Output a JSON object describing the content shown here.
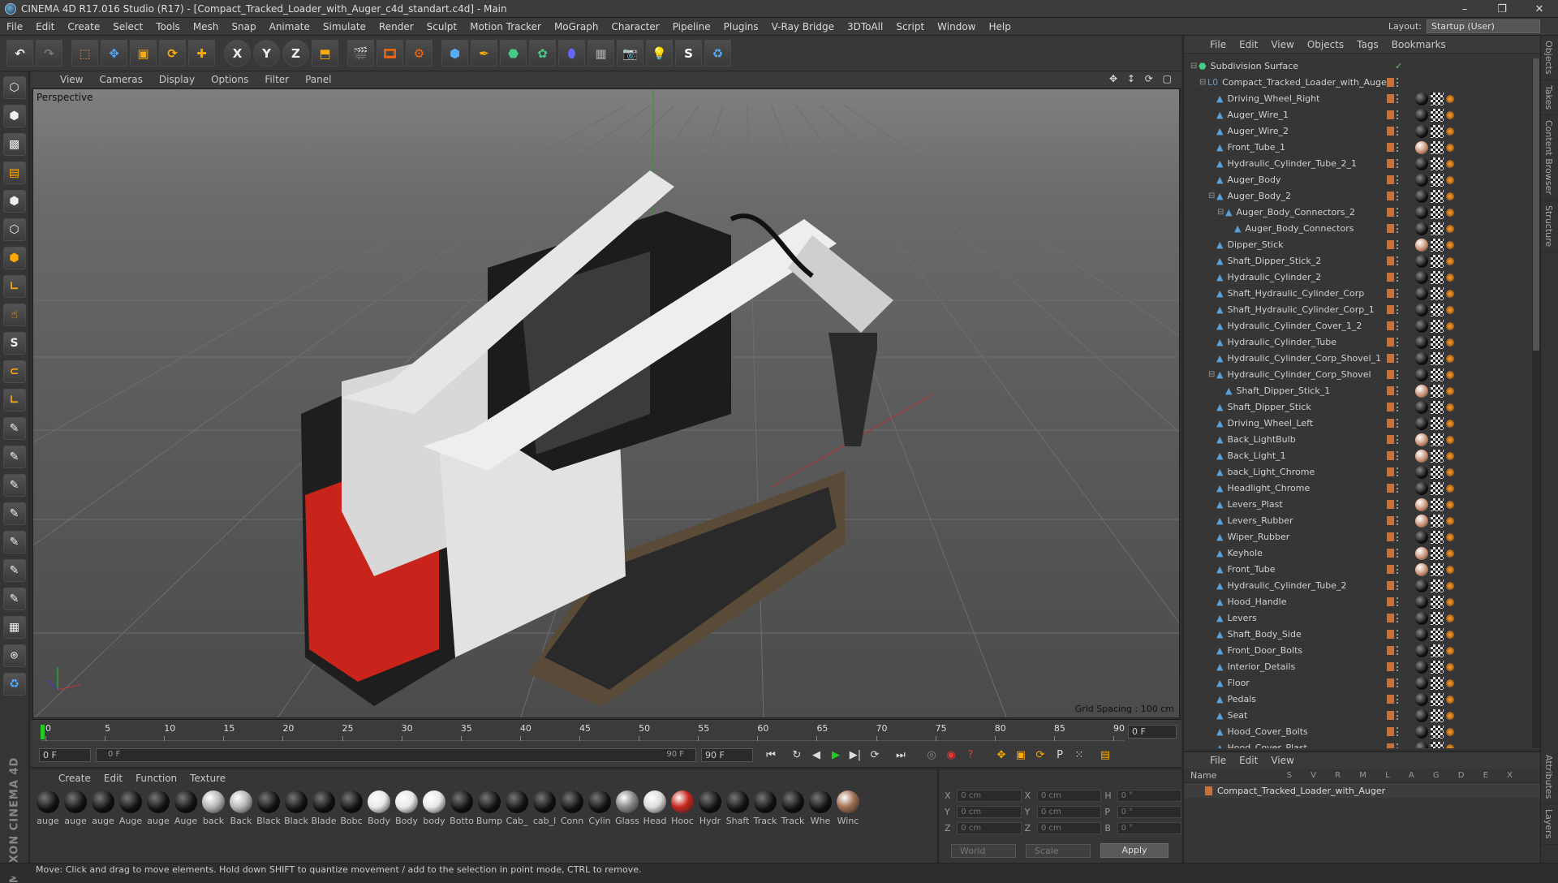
{
  "app": {
    "title": "CINEMA 4D R17.016 Studio (R17) - [Compact_Tracked_Loader_with_Auger_c4d_standart.c4d] - Main",
    "window_controls": [
      "–",
      "❐",
      "✕"
    ]
  },
  "menu": [
    "File",
    "Edit",
    "Create",
    "Select",
    "Tools",
    "Mesh",
    "Snap",
    "Animate",
    "Simulate",
    "Render",
    "Sculpt",
    "Motion Tracker",
    "MoGraph",
    "Character",
    "Pipeline",
    "Plugins",
    "V-Ray Bridge",
    "3DToAll",
    "Script",
    "Window",
    "Help"
  ],
  "layout": {
    "label": "Layout:",
    "value": "Startup (User)"
  },
  "toolbar": {
    "x": "X",
    "y": "Y",
    "z": "Z"
  },
  "viewport": {
    "menu": [
      "View",
      "Cameras",
      "Display",
      "Options",
      "Filter",
      "Panel"
    ],
    "camera_label": "Perspective",
    "grid_spacing": "Grid Spacing : 100 cm",
    "nav_icons": "✥ ↕ ⟳ ▢"
  },
  "timeline": {
    "ticks": [
      "0",
      "5",
      "10",
      "15",
      "20",
      "25",
      "30",
      "35",
      "40",
      "45",
      "50",
      "55",
      "60",
      "65",
      "70",
      "75",
      "80",
      "85",
      "90"
    ],
    "end_field": "0 F",
    "max_frame": 90
  },
  "transport": {
    "current_frame": "0 F",
    "range_start": "0 F",
    "range_end": "90 F",
    "max_field": "90 F"
  },
  "material_panel": {
    "menu": [
      "Create",
      "Edit",
      "Function",
      "Texture"
    ],
    "materials": [
      "auge",
      "auge",
      "auge",
      "Auge",
      "auge",
      "Auge",
      "back",
      "Back",
      "Black",
      "Black",
      "Blade",
      "Bobc",
      "Body",
      "Body",
      "body",
      "Botto",
      "Bump",
      "Cab_",
      "cab_l",
      "Conn",
      "Cylin",
      "Glass",
      "Head",
      "Hooc",
      "Hydr",
      "Shaft",
      "Track",
      "Track",
      "Whe",
      "Winc"
    ],
    "maxon_logo": "MAXON CINEMA 4D"
  },
  "coordinates": {
    "rows": [
      {
        "a": "X",
        "av": "0 cm",
        "b": "X",
        "bv": "0 cm",
        "c": "H",
        "cv": "0 °"
      },
      {
        "a": "Y",
        "av": "0 cm",
        "b": "Y",
        "bv": "0 cm",
        "c": "P",
        "cv": "0 °"
      },
      {
        "a": "Z",
        "av": "0 cm",
        "b": "Z",
        "bv": "0 cm",
        "c": "B",
        "cv": "0 °"
      }
    ],
    "mode": "World",
    "scale": "Scale",
    "apply": "Apply"
  },
  "object_manager": {
    "menu": [
      "File",
      "Edit",
      "View",
      "Objects",
      "Tags",
      "Bookmarks"
    ],
    "objects": [
      {
        "name": "Subdivision Surface",
        "level": 0,
        "kind": "sds",
        "expand": "-"
      },
      {
        "name": "Compact_Tracked_Loader_with_Auger",
        "level": 1,
        "kind": "null",
        "expand": "-"
      },
      {
        "name": "Driving_Wheel_Right",
        "level": 2,
        "kind": "poly",
        "expand": ""
      },
      {
        "name": "Auger_Wire_1",
        "level": 2,
        "kind": "poly",
        "expand": ""
      },
      {
        "name": "Auger_Wire_2",
        "level": 2,
        "kind": "poly",
        "expand": ""
      },
      {
        "name": "Front_Tube_1",
        "level": 2,
        "kind": "poly",
        "expand": ""
      },
      {
        "name": "Hydraulic_Cylinder_Tube_2_1",
        "level": 2,
        "kind": "poly",
        "expand": ""
      },
      {
        "name": "Auger_Body",
        "level": 2,
        "kind": "poly",
        "expand": ""
      },
      {
        "name": "Auger_Body_2",
        "level": 2,
        "kind": "poly",
        "expand": "-"
      },
      {
        "name": "Auger_Body_Connectors_2",
        "level": 3,
        "kind": "poly",
        "expand": "-"
      },
      {
        "name": "Auger_Body_Connectors",
        "level": 4,
        "kind": "poly",
        "expand": ""
      },
      {
        "name": "Dipper_Stick",
        "level": 2,
        "kind": "poly",
        "expand": ""
      },
      {
        "name": "Shaft_Dipper_Stick_2",
        "level": 2,
        "kind": "poly",
        "expand": ""
      },
      {
        "name": "Hydraulic_Cylinder_2",
        "level": 2,
        "kind": "poly",
        "expand": ""
      },
      {
        "name": "Shaft_Hydraulic_Cylinder_Corp",
        "level": 2,
        "kind": "poly",
        "expand": ""
      },
      {
        "name": "Shaft_Hydraulic_Cylinder_Corp_1",
        "level": 2,
        "kind": "poly",
        "expand": ""
      },
      {
        "name": "Hydraulic_Cylinder_Cover_1_2",
        "level": 2,
        "kind": "poly",
        "expand": ""
      },
      {
        "name": "Hydraulic_Cylinder_Tube",
        "level": 2,
        "kind": "poly",
        "expand": ""
      },
      {
        "name": "Hydraulic_Cylinder_Corp_Shovel_1",
        "level": 2,
        "kind": "poly",
        "expand": ""
      },
      {
        "name": "Hydraulic_Cylinder_Corp_Shovel",
        "level": 2,
        "kind": "poly",
        "expand": "-"
      },
      {
        "name": "Shaft_Dipper_Stick_1",
        "level": 3,
        "kind": "poly",
        "expand": ""
      },
      {
        "name": "Shaft_Dipper_Stick",
        "level": 2,
        "kind": "poly",
        "expand": ""
      },
      {
        "name": "Driving_Wheel_Left",
        "level": 2,
        "kind": "poly",
        "expand": ""
      },
      {
        "name": "Back_LightBulb",
        "level": 2,
        "kind": "poly",
        "expand": ""
      },
      {
        "name": "Back_Light_1",
        "level": 2,
        "kind": "poly",
        "expand": ""
      },
      {
        "name": "back_Light_Chrome",
        "level": 2,
        "kind": "poly",
        "expand": ""
      },
      {
        "name": "Headlight_Chrome",
        "level": 2,
        "kind": "poly",
        "expand": ""
      },
      {
        "name": "Levers_Plast",
        "level": 2,
        "kind": "poly",
        "expand": ""
      },
      {
        "name": "Levers_Rubber",
        "level": 2,
        "kind": "poly",
        "expand": ""
      },
      {
        "name": "Wiper_Rubber",
        "level": 2,
        "kind": "poly",
        "expand": ""
      },
      {
        "name": "Keyhole",
        "level": 2,
        "kind": "poly",
        "expand": ""
      },
      {
        "name": "Front_Tube",
        "level": 2,
        "kind": "poly",
        "expand": ""
      },
      {
        "name": "Hydraulic_Cylinder_Tube_2",
        "level": 2,
        "kind": "poly",
        "expand": ""
      },
      {
        "name": "Hood_Handle",
        "level": 2,
        "kind": "poly",
        "expand": ""
      },
      {
        "name": "Levers",
        "level": 2,
        "kind": "poly",
        "expand": ""
      },
      {
        "name": "Shaft_Body_Side",
        "level": 2,
        "kind": "poly",
        "expand": ""
      },
      {
        "name": "Front_Door_Bolts",
        "level": 2,
        "kind": "poly",
        "expand": ""
      },
      {
        "name": "Interior_Details",
        "level": 2,
        "kind": "poly",
        "expand": ""
      },
      {
        "name": "Floor",
        "level": 2,
        "kind": "poly",
        "expand": ""
      },
      {
        "name": "Pedals",
        "level": 2,
        "kind": "poly",
        "expand": ""
      },
      {
        "name": "Seat",
        "level": 2,
        "kind": "poly",
        "expand": ""
      },
      {
        "name": "Hood_Cover_Bolts",
        "level": 2,
        "kind": "poly",
        "expand": ""
      },
      {
        "name": "Hood_Cover_Plast",
        "level": 2,
        "kind": "poly",
        "expand": ""
      }
    ]
  },
  "right_tabs": [
    "Objects",
    "Takes",
    "Content Browser",
    "Structure"
  ],
  "attr_tabs": [
    "Attributes",
    "Layers"
  ],
  "attribute_panel": {
    "menu": [
      "File",
      "Edit",
      "View"
    ],
    "name_header": "Name",
    "columns": "S V R M L A G D E X",
    "row": "Compact_Tracked_Loader_with_Auger"
  },
  "status": "Move: Click and drag to move elements. Hold down SHIFT to quantize movement / add to the selection in point mode, CTRL to remove.",
  "colors": {
    "accent_orange": "#d07030",
    "object_blue": "#5aa0d8",
    "body_red": "#c8241c"
  }
}
